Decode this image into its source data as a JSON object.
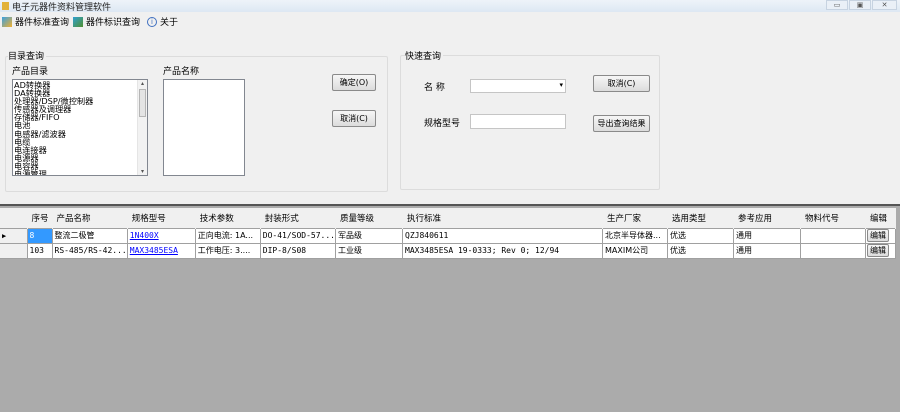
{
  "window": {
    "title": "电子元器件资料管理软件",
    "controls": [
      "minimize",
      "maximize",
      "close"
    ]
  },
  "menu": [
    {
      "label": "器件标准查询",
      "icon": "standard-query-icon"
    },
    {
      "label": "器件标识查询",
      "icon": "marking-query-icon"
    },
    {
      "label": "关于",
      "icon": "info-icon"
    }
  ],
  "catalog": {
    "group_label": "目录查询",
    "list_label": "产品目录",
    "name_label": "产品名称",
    "items": [
      "AD转换器",
      "DA转换器",
      "处理器/DSP/微控制器",
      "传感器及调理器",
      "存储器/FIFO",
      "电池",
      "电感器/滤波器",
      "电缆",
      "电连接器",
      "电源器",
      "电容器",
      "电源管理"
    ],
    "ok_button": "确定(O)",
    "cancel_button": "取消(C)"
  },
  "quick": {
    "group_label": "快速查询",
    "name_label": "名 称",
    "name_value": "",
    "model_label": "规格型号",
    "model_value": "",
    "cancel_button": "取消(C)",
    "export_button": "导出查询结果"
  },
  "table": {
    "columns": [
      "序号",
      "产品名称",
      "规格型号",
      "技术参数",
      "封装形式",
      "质量等级",
      "执行标准",
      "生产厂家",
      "选用类型",
      "参考应用",
      "物料代号",
      "编辑"
    ],
    "rows": [
      [
        "8",
        "整流二极管",
        "1N400X",
        "正向电流: 1A...",
        "DO-41/SOD-57...",
        "军品级",
        "QZJ840611",
        "北京半导体器...",
        "优选",
        "通用",
        "",
        "编辑"
      ],
      [
        "103",
        "RS-485/RS-42...",
        "MAX3485ESA",
        "工作电压: 3....",
        "DIP-8/S08",
        "工业级",
        "MAX3485ESA 19-0333; Rev 0; 12/94",
        "MAXIM公司",
        "优选",
        "通用",
        "",
        "编辑"
      ]
    ],
    "current_row": 0
  }
}
